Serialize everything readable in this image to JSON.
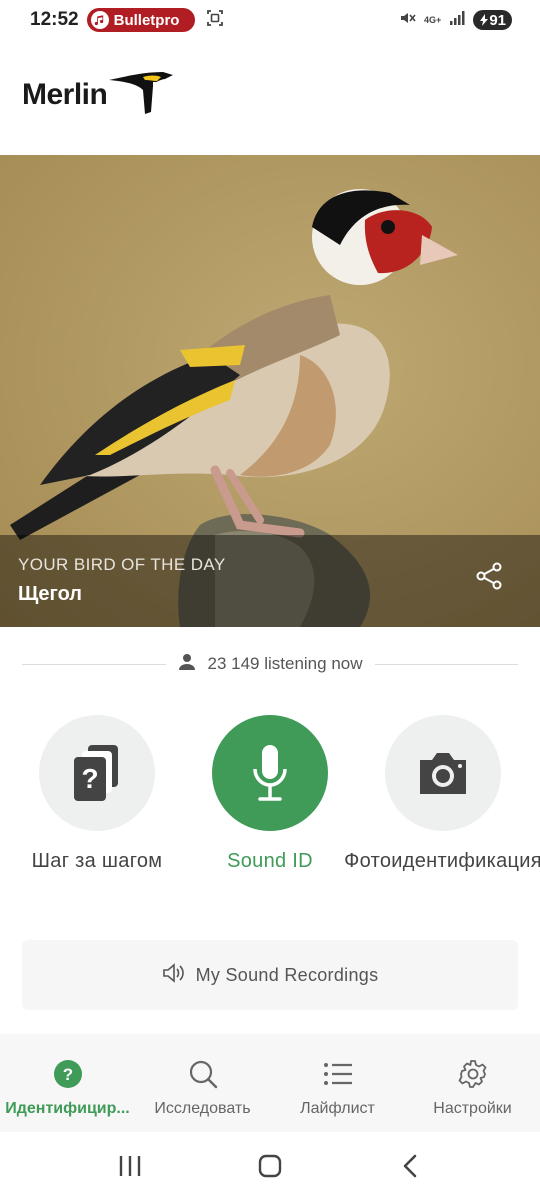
{
  "status_bar": {
    "time": "12:52",
    "notification_app": "Bulletpro",
    "network": "4G+",
    "battery": "91"
  },
  "header": {
    "logo_text": "Merlin"
  },
  "hero": {
    "kicker": "YOUR BIRD OF THE DAY",
    "bird_name": "Щегол",
    "share_icon": "share-icon"
  },
  "listening": {
    "text": "23 149 listening now",
    "icon": "person-icon"
  },
  "actions": [
    {
      "label": "Шаг за шагом",
      "icon": "question-cards-icon"
    },
    {
      "label": "Sound ID",
      "icon": "microphone-icon"
    },
    {
      "label": "Фотоидентификация",
      "icon": "camera-icon"
    }
  ],
  "recordings": {
    "label": "My Sound Recordings",
    "icon": "speaker-icon"
  },
  "bottom_nav": [
    {
      "label": "Идентифицир...",
      "icon": "help-circle-icon",
      "active": true
    },
    {
      "label": "Исследовать",
      "icon": "search-icon",
      "active": false
    },
    {
      "label": "Лайфлист",
      "icon": "list-icon",
      "active": false
    },
    {
      "label": "Настройки",
      "icon": "gear-icon",
      "active": false
    }
  ],
  "colors": {
    "accent_green": "#3f9b57",
    "notif_red": "#b01e24"
  }
}
